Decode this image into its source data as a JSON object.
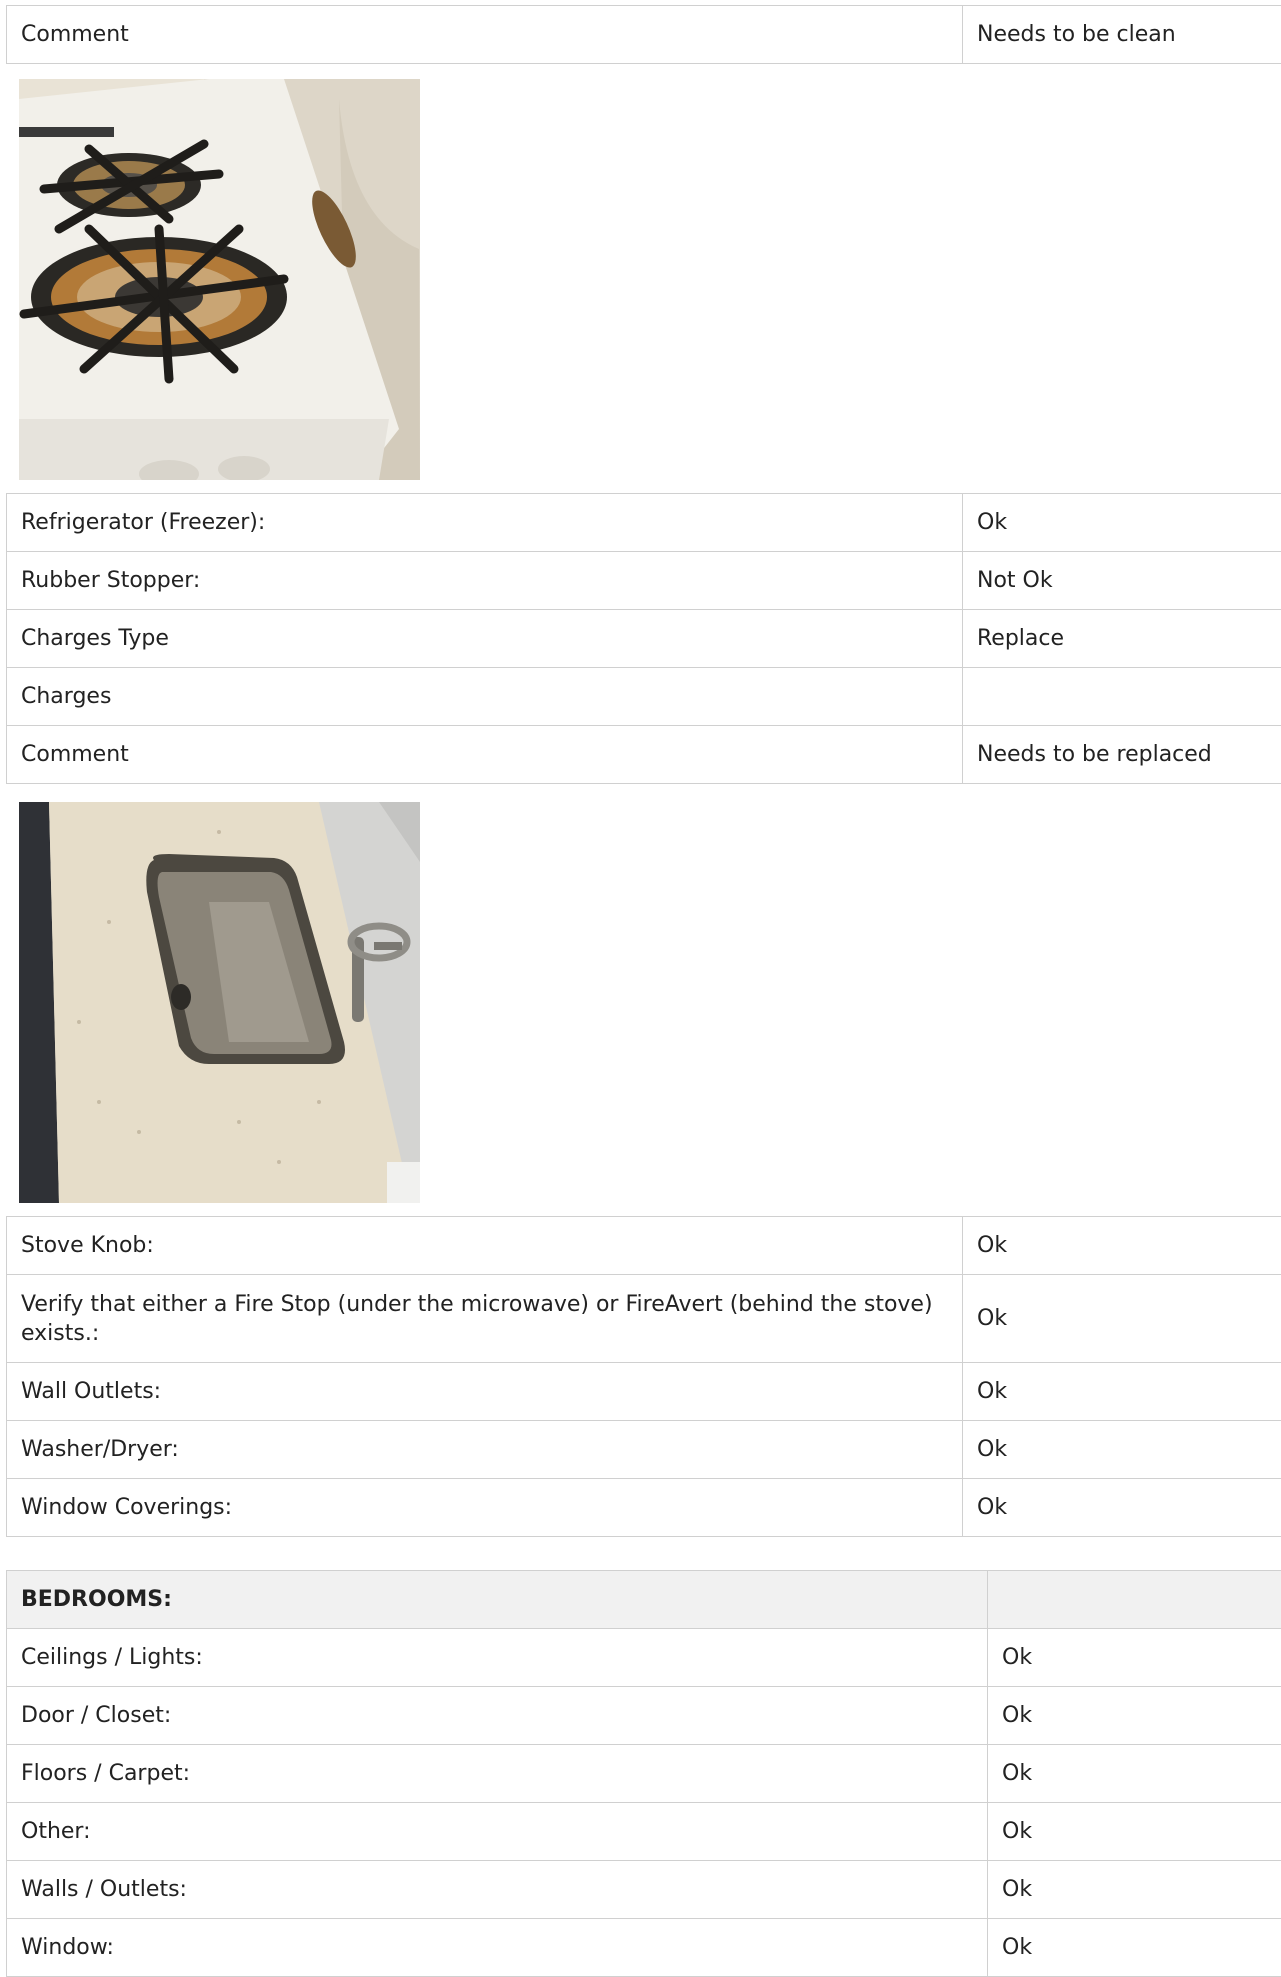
{
  "top_table": {
    "rows": [
      {
        "label": "Comment",
        "value": "Needs to be clean"
      }
    ]
  },
  "photo_1": {
    "subject": "stove-burners-photo"
  },
  "middle_table": {
    "rows": [
      {
        "label": "Refrigerator (Freezer):",
        "value": "Ok"
      },
      {
        "label": "Rubber Stopper:",
        "value": "Not Ok"
      },
      {
        "label": "Charges Type",
        "value": "Replace"
      },
      {
        "label": "Charges",
        "value": ""
      },
      {
        "label": "Comment",
        "value": "Needs to be replaced"
      }
    ]
  },
  "photo_2": {
    "subject": "sink-countertop-photo"
  },
  "kitchen_table": {
    "rows": [
      {
        "label": "Stove Knob:",
        "value": "Ok"
      },
      {
        "label": "Verify that either a Fire Stop (under the microwave) or FireAvert (behind the stove) exists.:",
        "value": "Ok"
      },
      {
        "label": "Wall Outlets:",
        "value": "Ok"
      },
      {
        "label": "Washer/Dryer:",
        "value": "Ok"
      },
      {
        "label": "Window Coverings:",
        "value": "Ok"
      }
    ]
  },
  "bedrooms_table": {
    "header": {
      "label": "BEDROOMS:",
      "value": ""
    },
    "rows": [
      {
        "label": "Ceilings / Lights:",
        "value": "Ok"
      },
      {
        "label": "Door / Closet:",
        "value": "Ok"
      },
      {
        "label": "Floors / Carpet:",
        "value": "Ok"
      },
      {
        "label": "Other:",
        "value": "Ok"
      },
      {
        "label": "Walls / Outlets:",
        "value": "Ok"
      },
      {
        "label": "Window:",
        "value": "Ok"
      }
    ]
  }
}
